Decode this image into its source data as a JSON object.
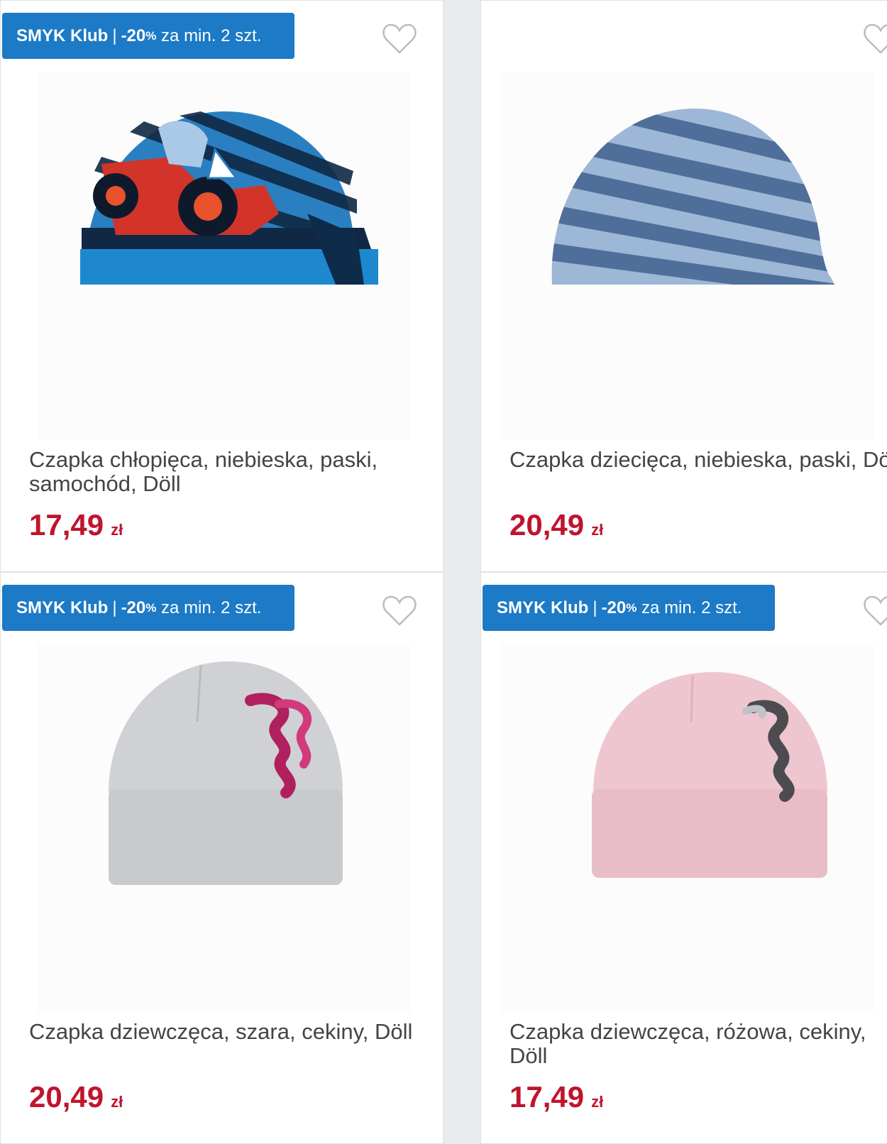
{
  "products": [
    {
      "badge": {
        "brand": "SMYK Klub",
        "discount": "-20",
        "pct": "%",
        "condition": "za min. 2 szt."
      },
      "title": "Czapka chłopięca, niebieska, paski, samochód, Döll",
      "price": "17,49",
      "currency": "zł"
    },
    {
      "title": "Czapka dziecięca, niebieska, paski, Döll",
      "price": "20,49",
      "currency": "zł"
    },
    {
      "badge": {
        "brand": "SMYK Klub",
        "discount": "-20",
        "pct": "%",
        "condition": "za min. 2 szt."
      },
      "title": "Czapka dziewczęca, szara, cekiny, Döll",
      "price": "20,49",
      "currency": "zł"
    },
    {
      "badge": {
        "brand": "SMYK Klub",
        "discount": "-20",
        "pct": "%",
        "condition": "za min. 2 szt."
      },
      "title": "Czapka dziewczęca, różowa, cekiny, Döll",
      "price": "17,49",
      "currency": "zł"
    }
  ],
  "colors": {
    "badge": "#1c7ac6",
    "price": "#c0142c"
  },
  "icons": {
    "favorite": "heart-outline-icon"
  }
}
